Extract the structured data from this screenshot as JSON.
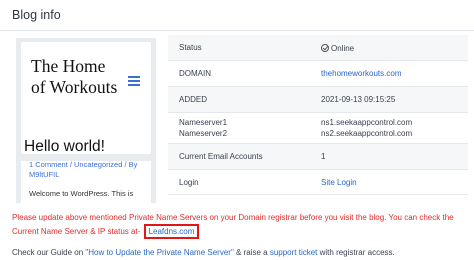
{
  "header": {
    "title": "Blog info"
  },
  "preview": {
    "site_title": "The Home of Workouts",
    "post_title": "Hello world!",
    "post_meta": "1 Comment / Uncategorized / By M9ltUFIL",
    "post_excerpt": "Welcome to WordPress. This is"
  },
  "info": {
    "status": {
      "label": "Status",
      "value": "Online"
    },
    "domain": {
      "label": "DOMAIN",
      "value": "thehomeworkouts.com"
    },
    "added": {
      "label": "ADDED",
      "value": "2021-09-13 09:15:25"
    },
    "nameservers": {
      "label1": "Nameserver1",
      "label2": "Nameserver2",
      "value1": "ns1.seekaappcontrol.com",
      "value2": "ns2.seekaappcontrol.com"
    },
    "email": {
      "label": "Current Email Accounts",
      "value": "1"
    },
    "login": {
      "label": "Login",
      "value": "Site Login"
    }
  },
  "warning": {
    "text": "Please update above mentioned Private Name Servers on your Domain registrar before you visit the blog. You can check the Current Name Server & IP status at-",
    "link": "Leafdns.com"
  },
  "guide": {
    "prefix": "Check our Guide on ",
    "link": "\"How to Update the Private Name Server\"",
    "middle": " & raise a ",
    "ticket": "support ticket",
    "suffix": " with registrar access."
  }
}
